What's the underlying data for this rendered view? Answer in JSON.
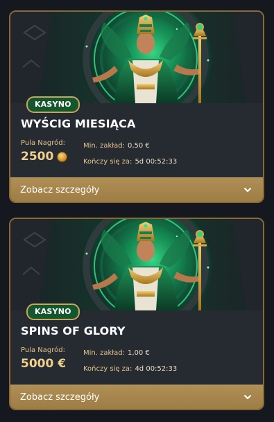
{
  "cards": [
    {
      "badge": "KASYNO",
      "title": "WYŚCIG MIESIĄCA",
      "pool_label": "Pula Nagród:",
      "pool_value": "2500",
      "pool_icon": "coin-icon",
      "min_bet_label": "Min. zakład:",
      "min_bet_value": "0,50 €",
      "ends_label": "Kończy się za:",
      "ends_value": "5d 00:52:33",
      "details_label": "Zobacz szczegóły"
    },
    {
      "badge": "KASYNO",
      "title": "SPINS OF GLORY",
      "pool_label": "Pula Nagród:",
      "pool_value": "5000 €",
      "min_bet_label": "Min. zakład:",
      "min_bet_value": "1,00 €",
      "ends_label": "Kończy się za:",
      "ends_value": "4d 00:52:33",
      "details_label": "Zobacz szczegóły"
    }
  ],
  "colors": {
    "page_bg": "#15191f",
    "card_bg": "#262a31",
    "gold_border": "#8a6a34",
    "badge_green": "#14572e",
    "footer_gold": "#b08f55"
  }
}
